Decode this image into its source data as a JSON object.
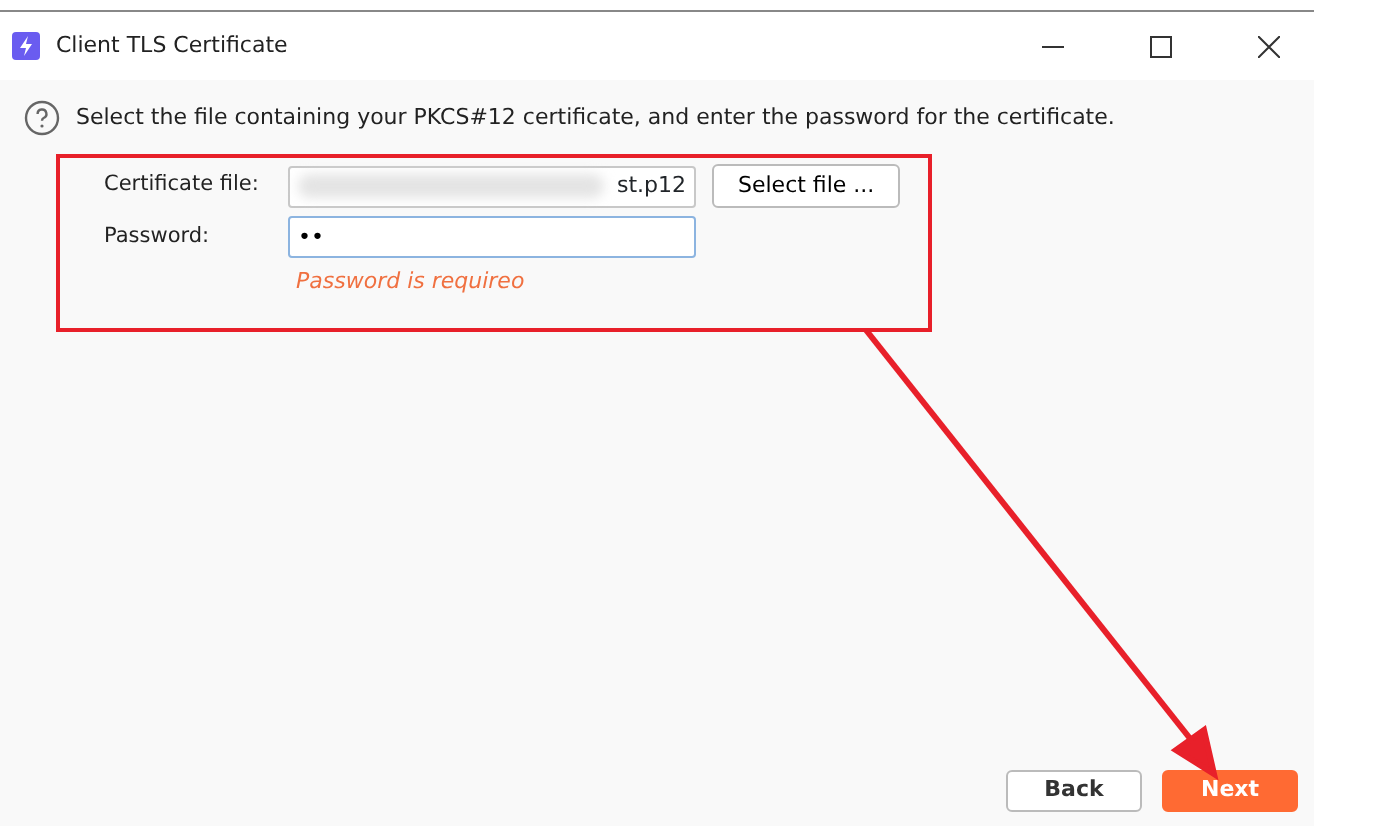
{
  "window": {
    "title": "Client TLS Certificate"
  },
  "instruction": "Select the file containing your PKCS#12 certificate, and enter the password for the certificate.",
  "fields": [
    {
      "kind": "file",
      "label": "Certificate file:",
      "value": "st.p12",
      "button": "Select file ..."
    },
    {
      "kind": "password",
      "label": "Password:",
      "value": "••",
      "error": "Password is requireo"
    }
  ],
  "buttons": [
    {
      "label": "Back",
      "primary": false
    },
    {
      "label": "Next",
      "primary": true
    }
  ]
}
